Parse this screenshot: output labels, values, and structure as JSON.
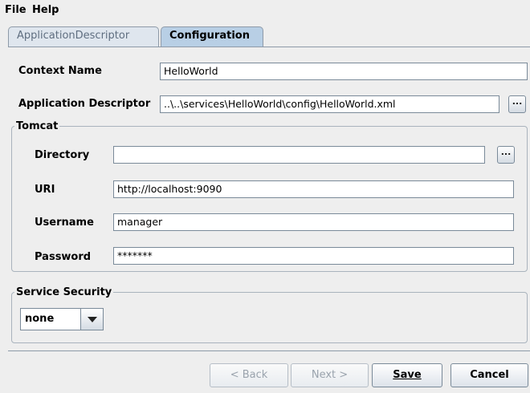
{
  "menu": {
    "file": "File",
    "help": "Help"
  },
  "tabs": [
    {
      "label": "ApplicationDescriptor",
      "active": false
    },
    {
      "label": "Configuration",
      "active": true
    }
  ],
  "context_name": {
    "label": "Context Name",
    "value": "HelloWorld"
  },
  "application_descriptor": {
    "label": "Application Descriptor",
    "value": "..\\..\\services\\HelloWorld\\config\\HelloWorld.xml",
    "browse_label": "..."
  },
  "tomcat": {
    "title": "Tomcat",
    "directory": {
      "label": "Directory",
      "value": "",
      "browse_label": "..."
    },
    "uri": {
      "label": "URI",
      "value": "http://localhost:9090"
    },
    "username": {
      "label": "Username",
      "value": "manager"
    },
    "password": {
      "label": "Password",
      "value": "*******"
    }
  },
  "service_security": {
    "title": "Service Security",
    "selected": "none"
  },
  "buttons": {
    "back": "< Back",
    "next": "Next >",
    "save": "Save",
    "cancel": "Cancel"
  }
}
